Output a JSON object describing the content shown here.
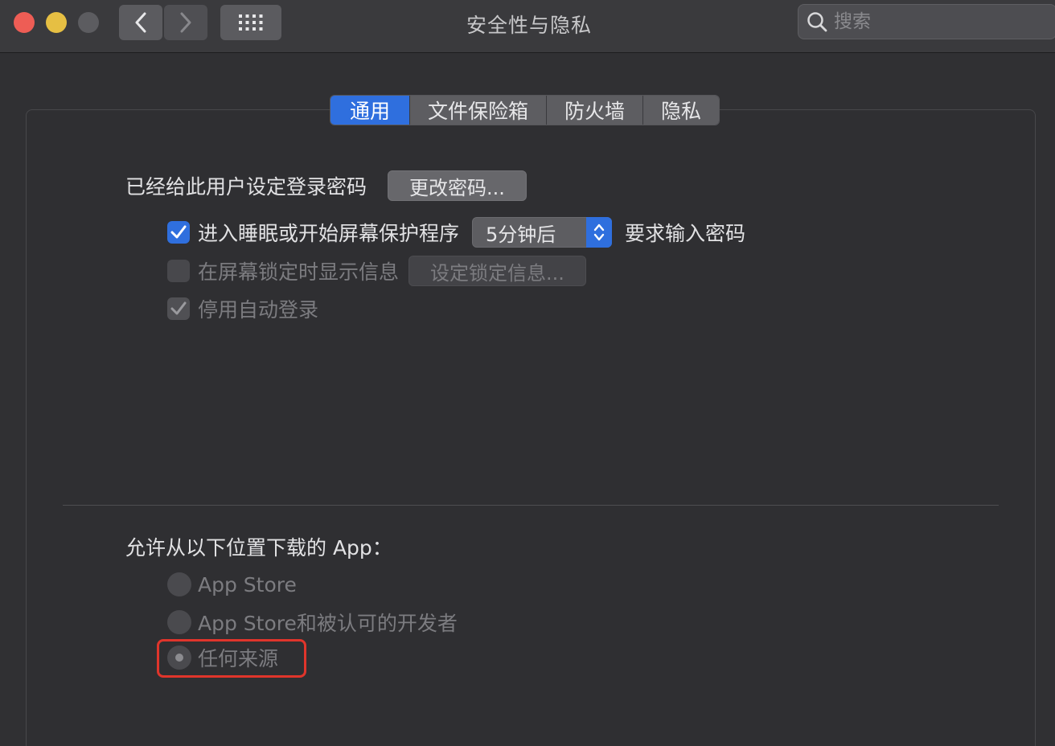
{
  "window": {
    "title": "安全性与隐私",
    "search_placeholder": "搜索"
  },
  "tabs": [
    {
      "label": "通用",
      "active": true
    },
    {
      "label": "文件保险箱",
      "active": false
    },
    {
      "label": "防火墙",
      "active": false
    },
    {
      "label": "隐私",
      "active": false
    }
  ],
  "general": {
    "login_password_label": "已经给此用户设定登录密码",
    "change_password_button": "更改密码...",
    "require_password": {
      "checked": true,
      "label": "进入睡眠或开始屏幕保护程序",
      "delay_value": "5分钟后",
      "suffix": "要求输入密码"
    },
    "lock_message": {
      "checked": false,
      "enabled": false,
      "label": "在屏幕锁定时显示信息",
      "button": "设定锁定信息..."
    },
    "disable_auto_login": {
      "checked": true,
      "enabled": false,
      "label": "停用自动登录"
    }
  },
  "allow_apps": {
    "heading": "允许从以下位置下载的 App：",
    "options": [
      {
        "label": "App Store",
        "selected": false
      },
      {
        "label": "App Store和被认可的开发者",
        "selected": false
      },
      {
        "label": "任何来源",
        "selected": true
      }
    ]
  },
  "colors": {
    "accent": "#2f6fde",
    "highlight": "#e0352b",
    "close": "#ee5d55",
    "minimize": "#e6bf43"
  }
}
